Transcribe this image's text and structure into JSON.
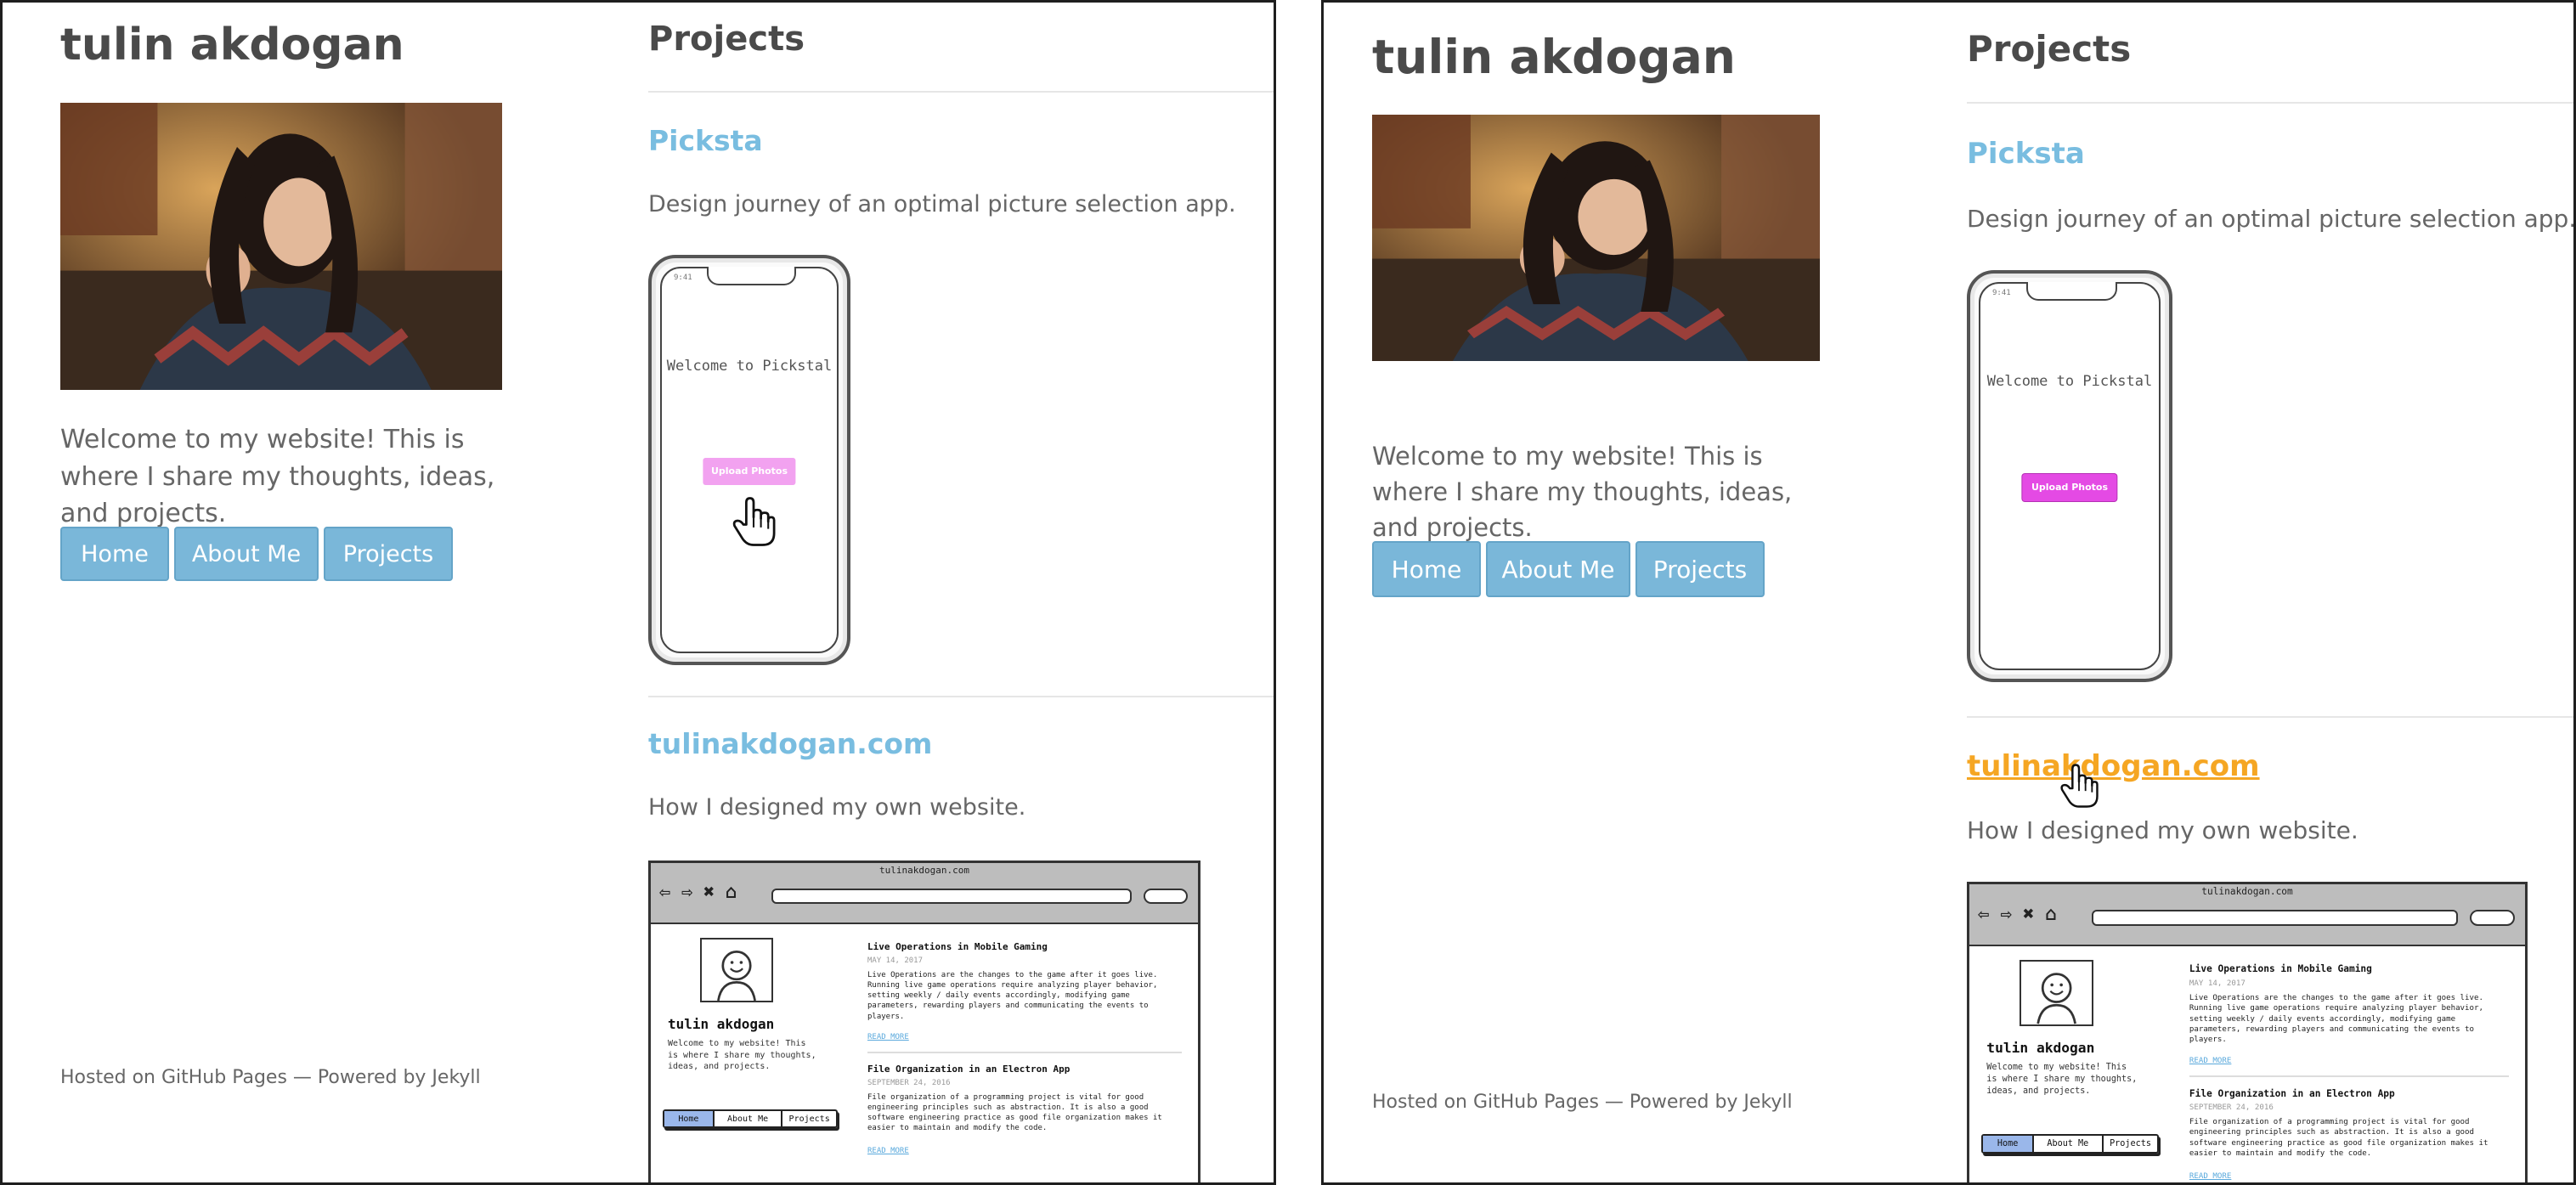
{
  "site": {
    "title": "tulin akdogan",
    "intro": "Welcome to my website! This is where I share my thoughts, ideas, and projects.",
    "nav": [
      "Home",
      "About Me",
      "Projects"
    ],
    "footer": "Hosted on GitHub Pages — Powered by Jekyll"
  },
  "projects": {
    "heading": "Projects",
    "items": [
      {
        "title": "Picksta",
        "description": "Design journey of an optimal picture selection app."
      },
      {
        "title": "tulinakdogan.com",
        "description": "How I designed my own website."
      }
    ]
  },
  "phone_mockup": {
    "welcome": "Welcome to Pickstal",
    "button": "Upload Photos",
    "status_time": "9:41",
    "button_color_disabled": "#f2a2f0",
    "button_color_active": "#e44ae4"
  },
  "browser_mockup": {
    "url": "tulinakdogan.com",
    "site_name": "tulin akdogan",
    "blurb": "Welcome to my website! This is where I share my thoughts, ideas, and projects.",
    "nav": [
      "Home",
      "About Me",
      "Projects"
    ],
    "posts": [
      {
        "title": "Live Operations in Mobile Gaming",
        "date": "MAY 14, 2017",
        "body": "Live Operations are the changes to the game after it goes live. Running live game operations require analyzing player behavior, setting weekly / daily events accordingly, modifying game parameters, rewarding players and communicating the events to players.",
        "link": "READ MORE"
      },
      {
        "title": "File Organization in an Electron App",
        "date": "SEPTEMBER 24, 2016",
        "body": "File organization of a programming project is vital for good engineering principles such as abstraction. It is also a good software engineering practice as good file organization makes it easier to maintain and modify the code.",
        "link": "READ MORE"
      }
    ]
  },
  "colors": {
    "accent": "#7ab7d9",
    "link": "#79bde0",
    "link_hover": "#f5a623",
    "text": "#666666",
    "heading": "#4a4a4a"
  }
}
